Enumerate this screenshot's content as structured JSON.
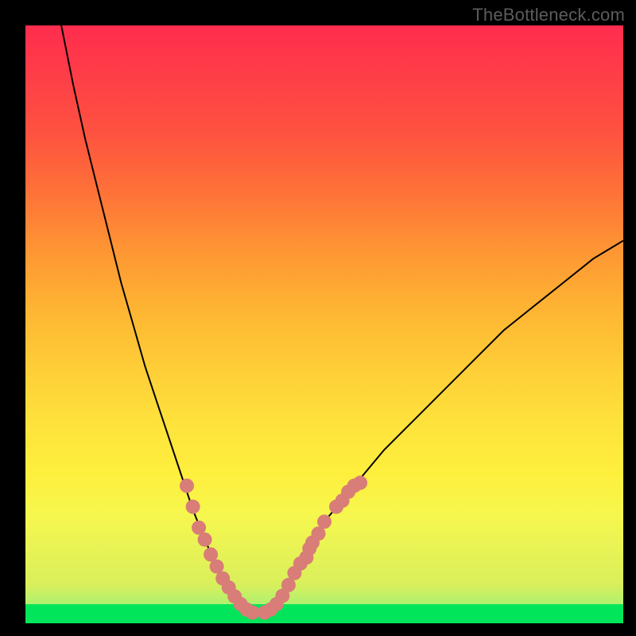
{
  "watermark": "TheBottleneck.com",
  "chart_data": {
    "type": "line",
    "title": "",
    "xlabel": "",
    "ylabel": "",
    "xlim": [
      0,
      100
    ],
    "ylim": [
      0,
      100
    ],
    "grid": false,
    "series": [
      {
        "name": "curve",
        "x": [
          6,
          8,
          10,
          12,
          14,
          16,
          18,
          20,
          22,
          24,
          26,
          28,
          30,
          32,
          34,
          36,
          38,
          40,
          42,
          44,
          46,
          48,
          50,
          55,
          60,
          65,
          70,
          75,
          80,
          85,
          90,
          95,
          100
        ],
        "y": [
          100,
          90,
          81,
          73,
          65,
          57,
          50,
          43,
          37,
          31,
          25,
          19,
          14,
          9.5,
          6,
          3.2,
          1.7,
          1.8,
          3.2,
          6,
          9.5,
          13,
          17,
          23,
          29,
          34,
          39,
          44,
          49,
          53,
          57,
          61,
          64
        ]
      }
    ],
    "markers": {
      "name": "highlighted-points",
      "color": "#d97d78",
      "points": [
        {
          "x": 27,
          "y": 23
        },
        {
          "x": 28,
          "y": 19.5
        },
        {
          "x": 29,
          "y": 16
        },
        {
          "x": 30,
          "y": 14
        },
        {
          "x": 31,
          "y": 11.5
        },
        {
          "x": 32,
          "y": 9.5
        },
        {
          "x": 33,
          "y": 7.5
        },
        {
          "x": 34,
          "y": 6
        },
        {
          "x": 35,
          "y": 4.5
        },
        {
          "x": 36,
          "y": 3.2
        },
        {
          "x": 37,
          "y": 2.3
        },
        {
          "x": 38,
          "y": 1.8
        },
        {
          "x": 40,
          "y": 1.8
        },
        {
          "x": 41,
          "y": 2.3
        },
        {
          "x": 42,
          "y": 3.2
        },
        {
          "x": 43,
          "y": 4.6
        },
        {
          "x": 44,
          "y": 6.4
        },
        {
          "x": 45,
          "y": 8.4
        },
        {
          "x": 46,
          "y": 10
        },
        {
          "x": 47,
          "y": 11
        },
        {
          "x": 47.5,
          "y": 12.5
        },
        {
          "x": 48,
          "y": 13.5
        },
        {
          "x": 49,
          "y": 15
        },
        {
          "x": 50,
          "y": 17
        },
        {
          "x": 52,
          "y": 19.5
        },
        {
          "x": 53,
          "y": 20.5
        },
        {
          "x": 54,
          "y": 22
        },
        {
          "x": 55,
          "y": 23
        },
        {
          "x": 56,
          "y": 23.5
        }
      ]
    },
    "background_gradient": {
      "direction": "bottom-to-top",
      "stops": [
        {
          "pos": 0.0,
          "color": "#00e55a"
        },
        {
          "pos": 0.05,
          "color": "#d9ef5c"
        },
        {
          "pos": 0.2,
          "color": "#fee33c"
        },
        {
          "pos": 0.5,
          "color": "#fe9733"
        },
        {
          "pos": 1.0,
          "color": "#ff2c4e"
        }
      ]
    }
  }
}
